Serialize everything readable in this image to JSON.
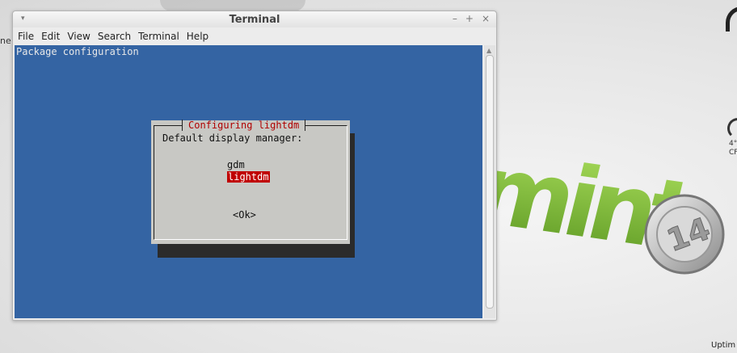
{
  "desktop": {
    "left_edge_text": "ne",
    "widget_text_line1": "4°",
    "widget_text_line2": "CF",
    "uptime_label": "Uptim",
    "logo_text": "mint",
    "logo_badge": "14",
    "colors": {
      "logo_green": "#86c440",
      "background": "#e6e6e6"
    }
  },
  "window": {
    "title": "Terminal",
    "menu_arrow": "▾",
    "buttons": {
      "minimize": "–",
      "maximize": "+",
      "close": "×"
    },
    "menu": [
      "File",
      "Edit",
      "View",
      "Search",
      "Terminal",
      "Help"
    ]
  },
  "terminal": {
    "header": "Package configuration",
    "background_color": "#3464a3",
    "dialog": {
      "title": "Configuring lightdm",
      "prompt": "Default display manager:",
      "options": [
        "gdm",
        "lightdm"
      ],
      "selected": "lightdm",
      "ok_button": "<Ok>"
    }
  }
}
